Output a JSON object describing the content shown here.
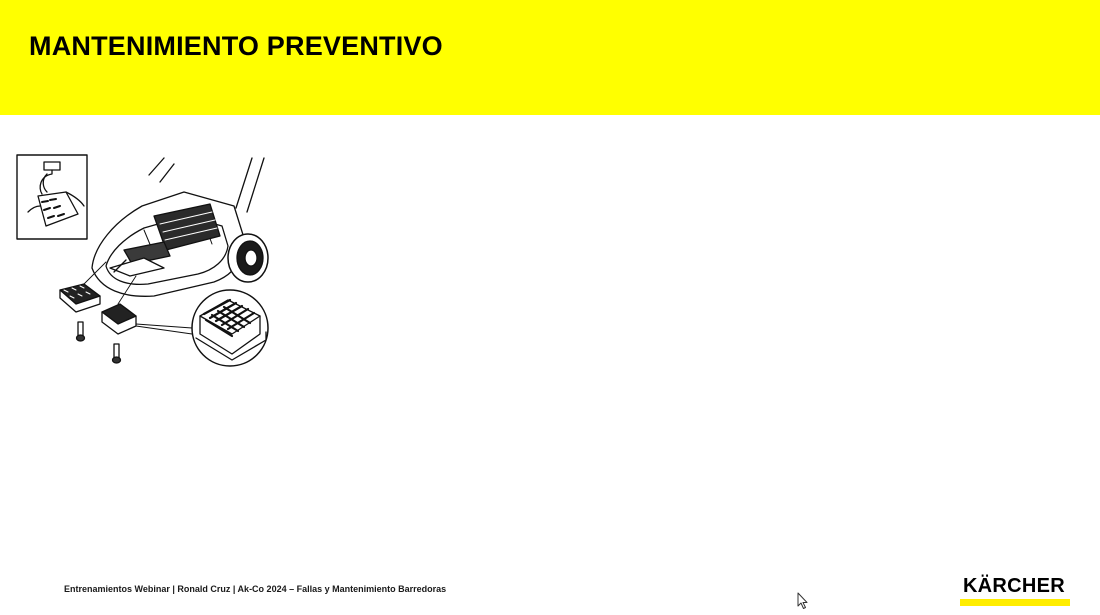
{
  "slide": {
    "title": "MANTENIMIENTO PREVENTIVO",
    "footer": "Entrenamientos Webinar | Ronald Cruz | Ak-Co 2024 – Fallas y Mantenimiento Barredoras"
  },
  "brand": {
    "logo_text": "KÄRCHER",
    "accent_color": "#ffff00",
    "logo_bar_color": "#ffed00"
  },
  "figure": {
    "icon": "sweeper-filter-maintenance-illustration"
  }
}
